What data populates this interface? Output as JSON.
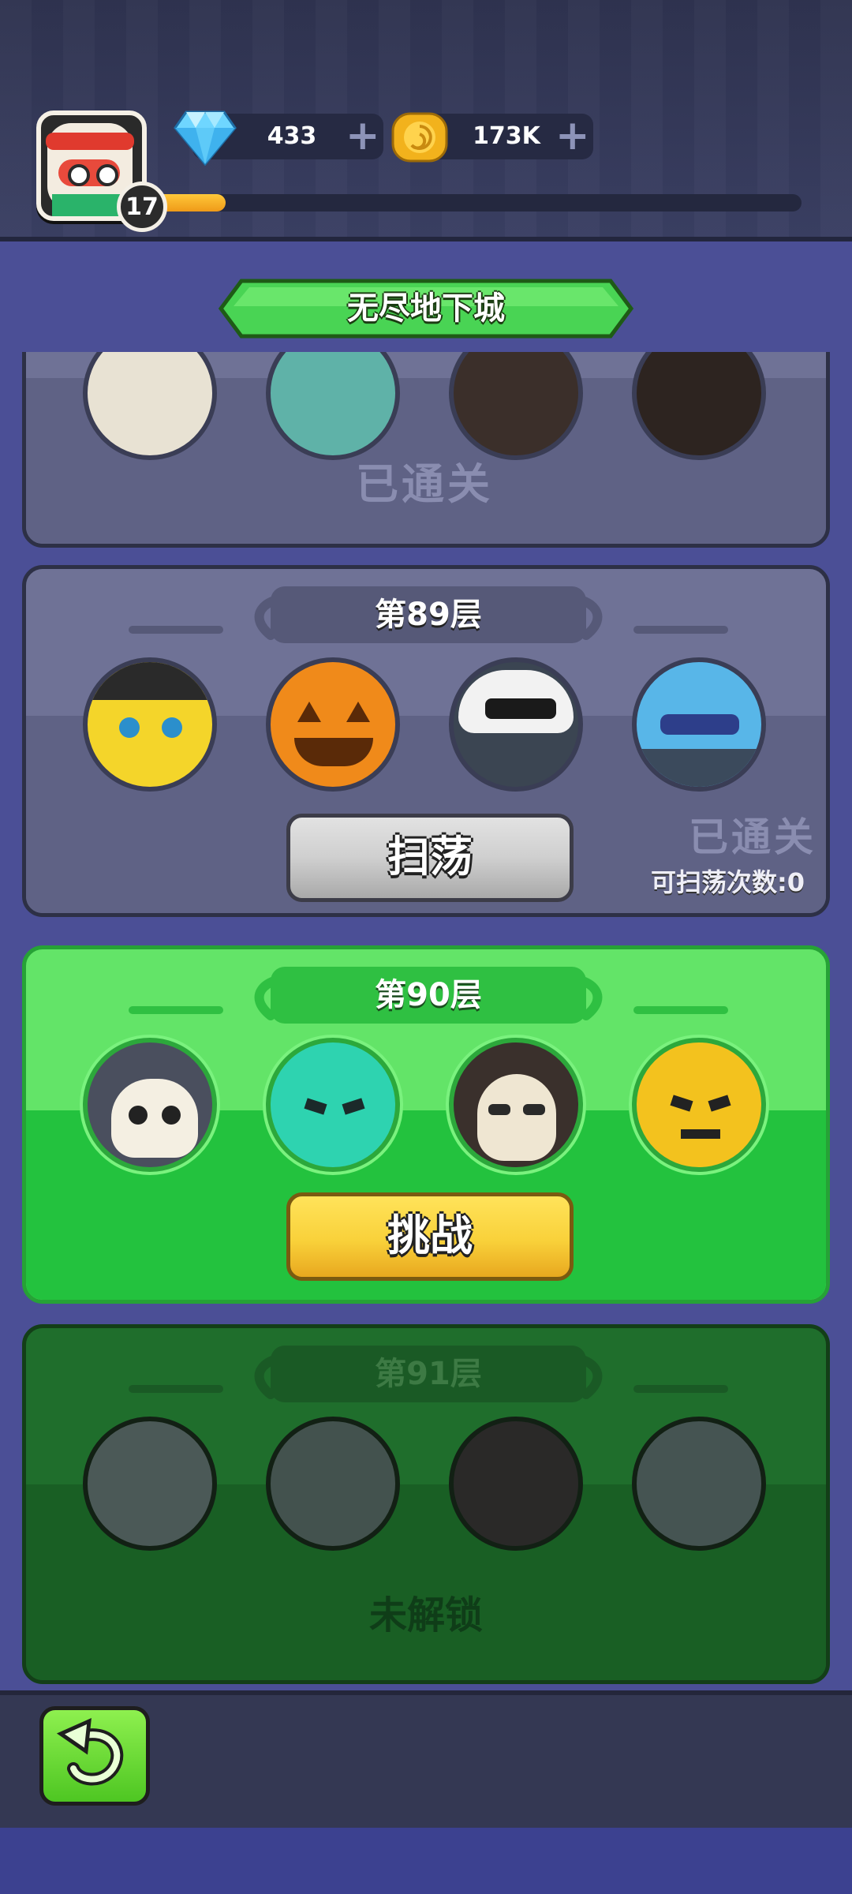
{
  "player": {
    "level": "17",
    "xp_progress": 0.11,
    "avatar": "chef-hero-avatar"
  },
  "currencies": {
    "gems": {
      "value": "433",
      "icon": "diamond-icon",
      "plus": "+"
    },
    "coins": {
      "value": "173K",
      "icon": "gold-coin-icon",
      "plus": "+"
    }
  },
  "title": "无尽地下城",
  "floors": {
    "cleared_prev": {
      "status": "已通关",
      "monsters": [
        "skull",
        "zombie-bear",
        "grim-skull",
        "grim-skull"
      ]
    },
    "f89": {
      "label": "第89层",
      "button": "扫荡",
      "status": "已通关",
      "sweep_count": "可扫荡次数:0",
      "monsters": [
        "yellow-skull-hat",
        "pumpkin",
        "ninja-robot",
        "blue-octopus"
      ]
    },
    "f90": {
      "label": "第90层",
      "button": "挑战",
      "monsters": [
        "skull-knight",
        "teal-block",
        "hooded-skull",
        "yellow-block"
      ]
    },
    "f91": {
      "label": "第91层",
      "status": "未解锁",
      "monsters": [
        "zombie-duck",
        "fly",
        "hooded-ghost",
        "zombie-duck"
      ]
    }
  },
  "colors": {
    "accent_green": "#63e468",
    "button_yellow": "#f9d13a",
    "xp_orange": "#ef9a18",
    "background": "#4b4f96"
  },
  "navigation": {
    "back_icon": "back-arrow-icon"
  }
}
